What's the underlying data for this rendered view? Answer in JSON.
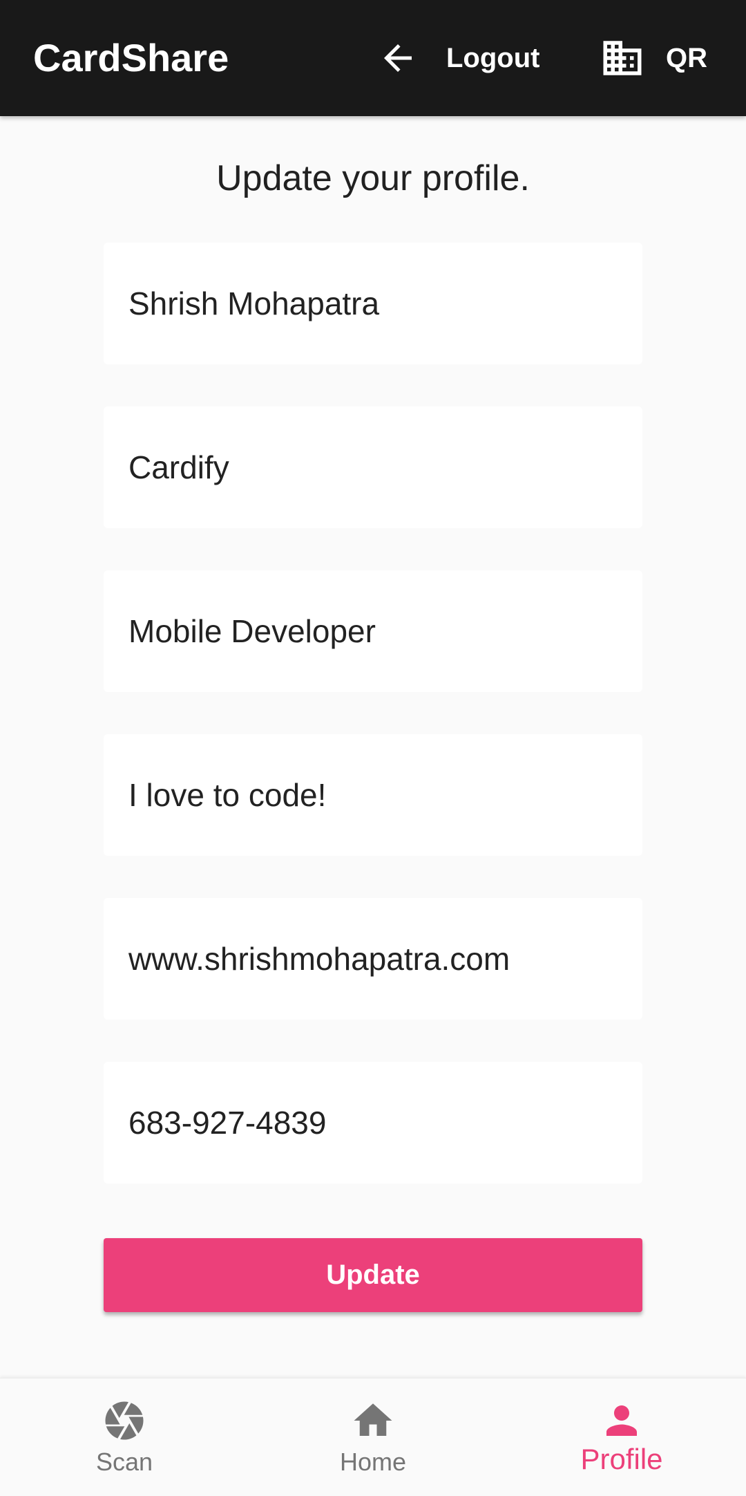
{
  "app_bar": {
    "title": "CardShare",
    "actions": [
      {
        "label": "Logout",
        "icon": "arrow-back-icon"
      },
      {
        "label": "QR",
        "icon": "building-icon"
      }
    ]
  },
  "main": {
    "heading": "Update your profile.",
    "fields": [
      {
        "name": "name",
        "value": "Shrish Mohapatra"
      },
      {
        "name": "company",
        "value": "Cardify"
      },
      {
        "name": "job-title",
        "value": "Mobile Developer"
      },
      {
        "name": "bio",
        "value": "I love to code!"
      },
      {
        "name": "website",
        "value": "www.shrishmohapatra.com"
      },
      {
        "name": "phone",
        "value": "683-927-4839"
      }
    ],
    "update_label": "Update"
  },
  "bottom_nav": {
    "items": [
      {
        "label": "Scan",
        "icon": "camera-aperture-icon",
        "active": false
      },
      {
        "label": "Home",
        "icon": "home-icon",
        "active": false
      },
      {
        "label": "Profile",
        "icon": "person-icon",
        "active": true
      }
    ]
  },
  "colors": {
    "app_bar": "#191919",
    "accent": "#ec407a",
    "background": "#fafafa",
    "field": "#ffffff",
    "inactive_nav": "#757575"
  }
}
